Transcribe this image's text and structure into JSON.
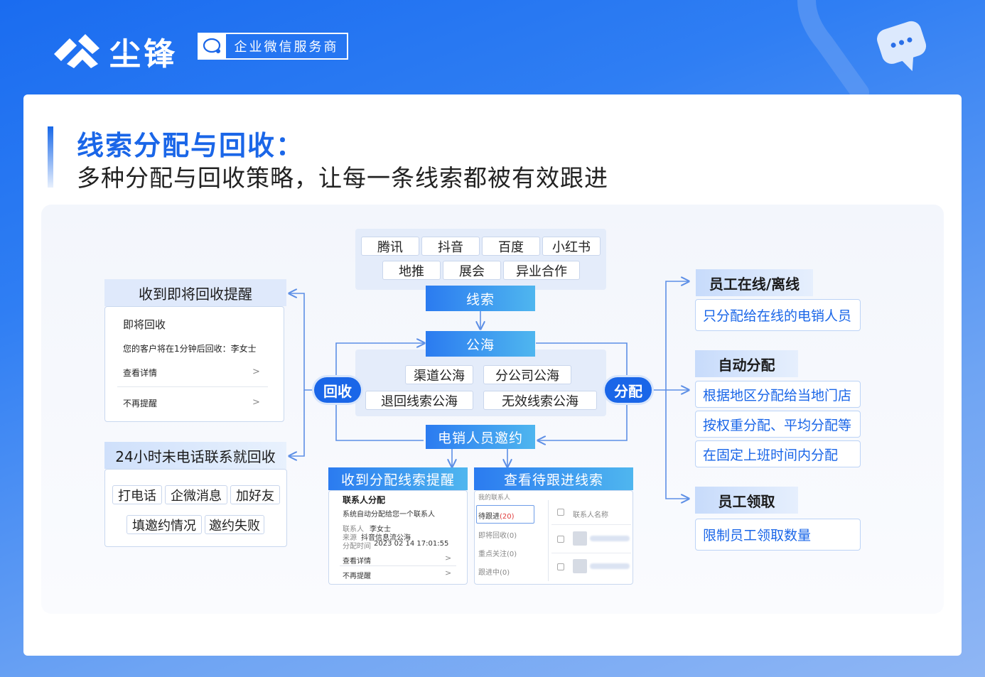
{
  "header": {
    "brand": "尘锋",
    "tagline": "企业微信服务商"
  },
  "title": {
    "main": "线索分配与回收：",
    "sub": "多种分配与回收策略，让每一条线索都被有效跟进"
  },
  "sources": {
    "row1": [
      "腾讯",
      "抖音",
      "百度",
      "小红书"
    ],
    "row2": [
      "地推",
      "展会",
      "异业合作"
    ]
  },
  "nodes": {
    "leads": "线索",
    "pool": "公海",
    "pool_items": [
      "渠道公海",
      "分公司公海",
      "退回线索公海",
      "无效线索公海"
    ],
    "recycle": "回收",
    "assign": "分配",
    "invite": "电销人员邀约"
  },
  "left": {
    "reminder_head": "收到即将回收提醒",
    "reminder_title": "即将回收",
    "reminder_desc": "您的客户将在1分钟后回收：李女士",
    "reminder_view": "查看详情",
    "reminder_mute": "不再提醒",
    "rule_head": "24小时未电话联系就回收",
    "actions_row1": [
      "打电话",
      "企微消息",
      "加好友"
    ],
    "actions_row2": [
      "填邀约情况",
      "邀约失败"
    ]
  },
  "bottom": {
    "notify_head": "收到分配线索提醒",
    "notify_title": "联系人分配",
    "notify_desc": "系统自动分配给您一个联系人",
    "contact_label": "联系人",
    "contact_value": "李女士",
    "source_label": "来源",
    "source_value": "抖音信息流公海",
    "time_label": "分配时间",
    "time_value": "2023 02 14  17:01:55",
    "view": "查看详情",
    "mute": "不再提醒",
    "pending_head": "查看待跟进线索",
    "my_contacts": "我的联系人",
    "tabs": [
      "待跟进",
      "即将回收",
      "重点关注",
      "跟进中"
    ],
    "counts": [
      "(20)",
      "(0)",
      "(0)",
      "(0)"
    ],
    "col_name": "联系人名称"
  },
  "right": {
    "online_head": "员工在线/离线",
    "online_items": [
      "只分配给在线的电销人员"
    ],
    "auto_head": "自动分配",
    "auto_items": [
      "根据地区分配给当地门店",
      "按权重分配、平均分配等",
      "在固定上班时间内分配"
    ],
    "claim_head": "员工领取",
    "claim_items": [
      "限制员工领取数量"
    ]
  },
  "colors": {
    "brand_blue": "#1a66e8",
    "light_blue": "#dfe9fb",
    "active_red": "#e03b3b"
  }
}
